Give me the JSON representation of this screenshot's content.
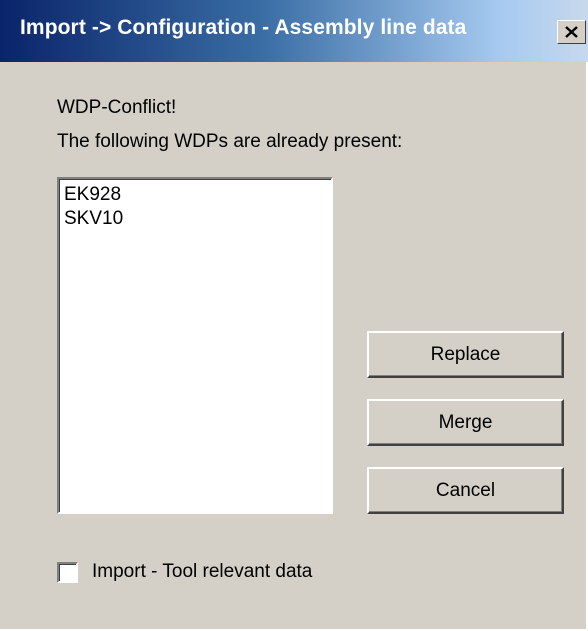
{
  "window": {
    "title": "Import -> Configuration - Assembly line data",
    "close_icon": "close-icon"
  },
  "message": {
    "line1": "WDP-Conflict!",
    "line2": "The following WDPs are already present:"
  },
  "wdp_list": {
    "items": [
      "EK928",
      "SKV10"
    ]
  },
  "buttons": {
    "replace": "Replace",
    "merge": "Merge",
    "cancel": "Cancel"
  },
  "option": {
    "label": "Import - Tool relevant data",
    "checked": false
  },
  "colors": {
    "title_bar_start": "#0a246a",
    "title_bar_end": "#a6caf0",
    "dialog_background": "#d4d0c8"
  }
}
